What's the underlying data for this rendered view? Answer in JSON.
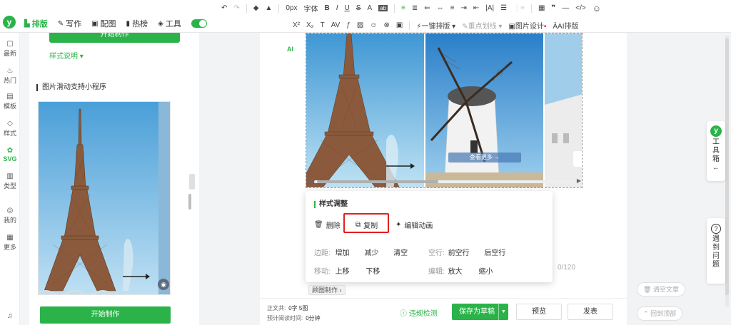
{
  "toolbar": {
    "row1": [
      "↶",
      "↷",
      "◆",
      "▲",
      "0px",
      "字体",
      "B",
      "I",
      "U",
      "S",
      "A",
      "ab",
      "≡",
      "≣",
      "⇐",
      "⇔",
      "≡",
      "⇥",
      "⇤",
      "|A|",
      "☰",
      "⋮≡",
      "▦",
      "❞",
      "—",
      "</>",
      "☺"
    ],
    "row1_labels": {
      "fontsize": "0px",
      "font": "字体"
    },
    "row2": {
      "sup": "X²",
      "sub": "X₂",
      "lineheight": "T",
      "letter": "AV",
      "fx": "ƒ",
      "img": "▨",
      "emoji": "☺",
      "link": "⊗",
      "briefcase": "▣"
    },
    "one_click_layout": "一键排版",
    "highlight_line": "重点划线",
    "image_design": "图片设计",
    "ai_layout": "AI排版"
  },
  "nav": {
    "tabs": [
      {
        "label": "排版",
        "icon": "layout-icon",
        "glyph": "▙"
      },
      {
        "label": "写作",
        "icon": "pen-icon",
        "glyph": "✎"
      },
      {
        "label": "配图",
        "icon": "image-icon",
        "glyph": "▣"
      },
      {
        "label": "热榜",
        "icon": "bookmark-icon",
        "glyph": "▮"
      },
      {
        "label": "工具",
        "icon": "cube-icon",
        "glyph": "◈"
      }
    ]
  },
  "sidebar": {
    "items": [
      {
        "label": "最新",
        "icon": "chat-icon",
        "glyph": "▢"
      },
      {
        "label": "热门",
        "icon": "flame-icon",
        "glyph": "♨"
      },
      {
        "label": "模板",
        "icon": "template-icon",
        "glyph": "▤"
      },
      {
        "label": "样式",
        "icon": "style-icon",
        "glyph": "◇"
      },
      {
        "label": "SVG",
        "icon": "svg-icon",
        "glyph": "✿"
      },
      {
        "label": "类型",
        "icon": "type-icon",
        "glyph": "▥"
      },
      {
        "label": "我的",
        "icon": "user-icon",
        "glyph": "◎"
      },
      {
        "label": "更多",
        "icon": "grid-icon",
        "glyph": "▦"
      },
      {
        "label": "",
        "icon": "headset-icon",
        "glyph": "♫"
      }
    ]
  },
  "panel": {
    "top_button": "开始制作",
    "style_desc": "样式说明 ▾",
    "card_title": "图片滑动支持小程序",
    "start_button": "开始制作"
  },
  "editor": {
    "ai_badge": "AI",
    "view_more": "查看更多 →",
    "popup": {
      "title": "样式调整",
      "delete": "删除",
      "copy": "复制",
      "edit_anim": "编辑动画",
      "margin_label": "边距:",
      "margin_inc": "增加",
      "margin_dec": "减少",
      "margin_clear": "清空",
      "spacing_label": "空行:",
      "spacing_before": "前空行",
      "spacing_after": "后空行",
      "move_label": "移动:",
      "move_up": "上移",
      "move_down": "下移",
      "edit_label": "编辑:",
      "zoom_in": "放大",
      "zoom_out": "缩小"
    },
    "counter": "0/120",
    "round_tag": "顾图制作 ›"
  },
  "footer": {
    "body_label": "正文共:",
    "body_value": "0字 5图",
    "read_label": "预计阅读时间:",
    "read_value": "0分钟",
    "check": "违规检测",
    "save_draft": "保存为草稿",
    "preview": "预览",
    "publish": "发表"
  },
  "right": {
    "toolbox": "工具箱←",
    "problem": "遇到问题",
    "clear": "清空文章",
    "back_top": "回到顶部"
  },
  "colors": {
    "brand": "#2bb34a",
    "highlight": "#e02020"
  }
}
